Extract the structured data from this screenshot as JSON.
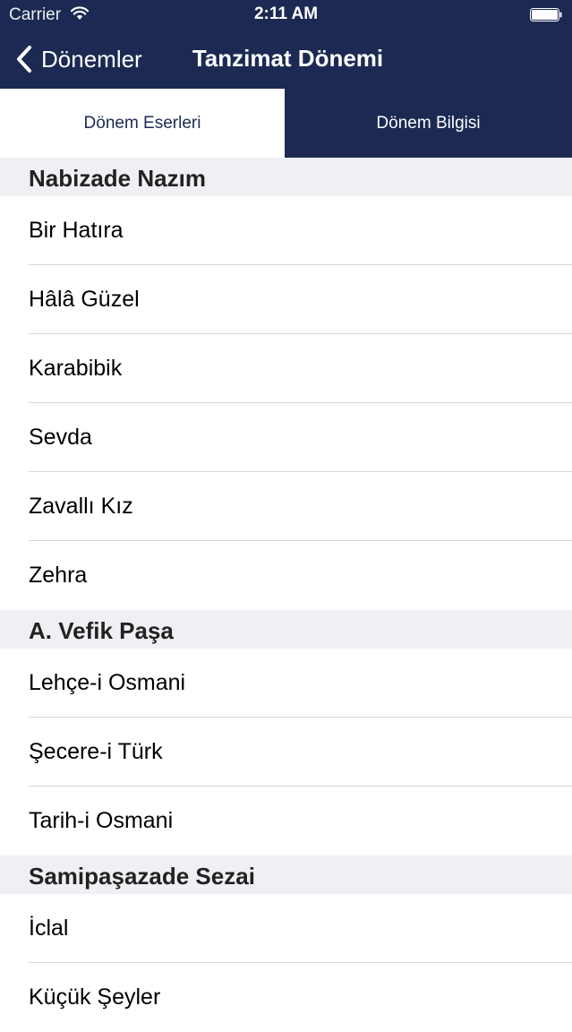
{
  "status_bar": {
    "carrier": "Carrier",
    "time": "2:11 AM",
    "wifi_icon": "wifi-icon",
    "battery_icon": "battery-icon"
  },
  "nav": {
    "back_label": "Dönemler",
    "title": "Tanzimat Dönemi"
  },
  "tabs": [
    {
      "label": "Dönem Eserleri",
      "active": true
    },
    {
      "label": "Dönem Bilgisi",
      "active": false
    }
  ],
  "sections": [
    {
      "header": "Nabizade Nazım",
      "items": [
        "Bir Hatıra",
        "Hâlâ Güzel",
        "Karabibik",
        "Sevda",
        "Zavallı Kız",
        "Zehra"
      ]
    },
    {
      "header": "A. Vefik Paşa",
      "items": [
        "Lehçe-i Osmani",
        "Şecere-i Türk",
        "Tarih-i Osmani"
      ]
    },
    {
      "header": "Samipaşazade Sezai",
      "items": [
        "İclal",
        "Küçük Şeyler"
      ]
    }
  ],
  "colors": {
    "nav_background": "#1c2a53",
    "section_header_background": "#f0f0f4",
    "separator": "#d6d6da"
  }
}
